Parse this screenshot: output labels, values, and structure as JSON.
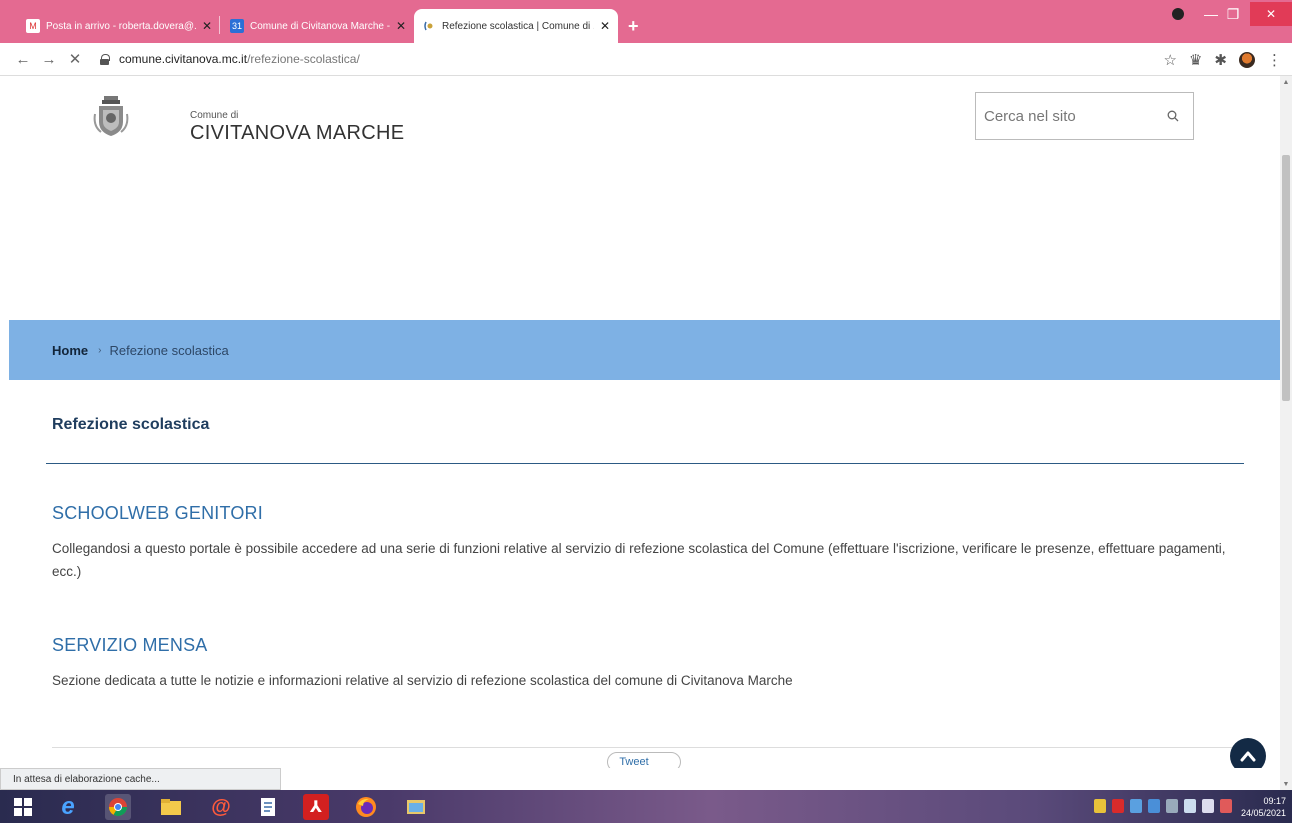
{
  "browser": {
    "tabs": [
      {
        "title": "Posta in arrivo - roberta.dovera@...",
        "favicon": "gmail-icon"
      },
      {
        "title": "Comune di Civitanova Marche - ...",
        "favicon": "calendar-icon"
      },
      {
        "title": "Refezione scolastica | Comune di ...",
        "favicon": "site-icon",
        "active": true
      }
    ],
    "new_tab_glyph": "+",
    "url_domain": "comune.civitanova.mc.it",
    "url_path": "/refezione-scolastica/",
    "status_text": "In attesa di elaborazione cache..."
  },
  "site": {
    "brand_small": "Comune di",
    "brand_name": "CIVITANOVA MARCHE",
    "search_placeholder": "Cerca nel sito"
  },
  "breadcrumb": {
    "home": "Home",
    "separator": "›",
    "current": "Refezione scolastica"
  },
  "content": {
    "title": "Refezione scolastica",
    "items": [
      {
        "link": "SCHOOLWEB GENITORI",
        "description": "Collegandosi a questo portale è possibile accedere ad una serie di funzioni relative al servizio di refezione scolastica del Comune (effettuare l'iscrizione, verificare le presenze, effettuare pagamenti, ecc.)"
      },
      {
        "link": "SERVIZIO MENSA",
        "description": "Sezione dedicata a tutte le notizie e informazioni relative al servizio di refezione scolastica del comune di Civitanova Marche"
      }
    ],
    "tweet_label": "Tweet"
  },
  "taskbar": {
    "time": "09:17",
    "date": "24/05/2021"
  },
  "colors": {
    "tabstrip": "#e46a91",
    "breadcrumb_bar": "#7eb1e4",
    "link": "#2f6ea8",
    "title": "#1f3d5e",
    "top_button": "#132a45"
  }
}
